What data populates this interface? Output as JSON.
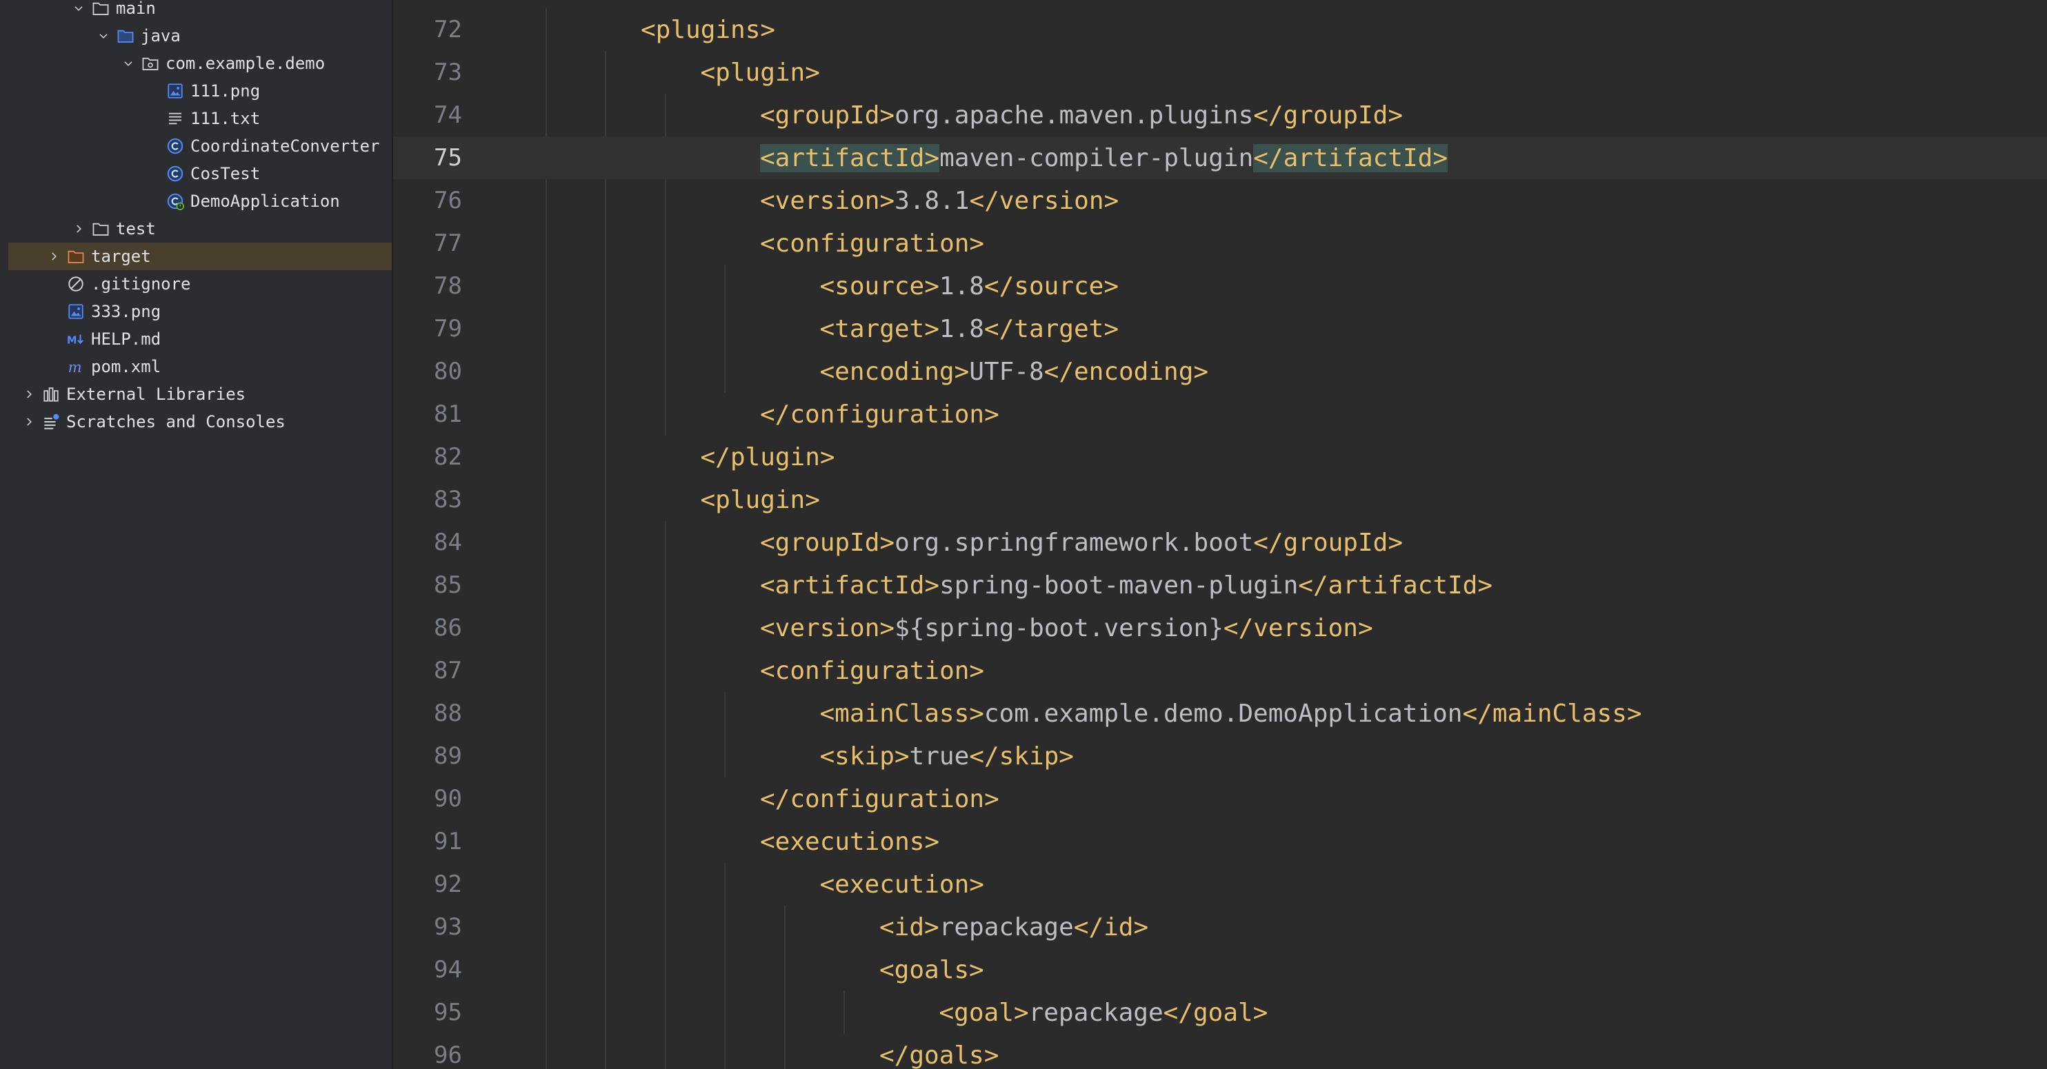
{
  "tree": {
    "rows": [
      {
        "label": "main",
        "indent": 2,
        "chevron": "down",
        "icon": "folder-icon",
        "selected": false
      },
      {
        "label": "java",
        "indent": 3,
        "chevron": "down",
        "icon": "source-folder-icon",
        "selected": false
      },
      {
        "label": "com.example.demo",
        "indent": 4,
        "chevron": "down",
        "icon": "package-icon",
        "selected": false
      },
      {
        "label": "111.png",
        "indent": 5,
        "chevron": "none",
        "icon": "image-file-icon",
        "selected": false
      },
      {
        "label": "111.txt",
        "indent": 5,
        "chevron": "none",
        "icon": "text-file-icon",
        "selected": false
      },
      {
        "label": "CoordinateConverter",
        "indent": 5,
        "chevron": "none",
        "icon": "java-class-icon",
        "selected": false
      },
      {
        "label": "CosTest",
        "indent": 5,
        "chevron": "none",
        "icon": "java-class-icon",
        "selected": false
      },
      {
        "label": "DemoApplication",
        "indent": 5,
        "chevron": "none",
        "icon": "spring-boot-class-icon",
        "selected": false
      },
      {
        "label": "test",
        "indent": 2,
        "chevron": "right",
        "icon": "folder-icon",
        "selected": false
      },
      {
        "label": "target",
        "indent": 1,
        "chevron": "right",
        "icon": "excluded-folder-icon",
        "selected": true
      },
      {
        "label": ".gitignore",
        "indent": 1,
        "chevron": "none",
        "icon": "ignored-file-icon",
        "selected": false
      },
      {
        "label": "333.png",
        "indent": 1,
        "chevron": "none",
        "icon": "image-file-icon",
        "selected": false
      },
      {
        "label": "HELP.md",
        "indent": 1,
        "chevron": "none",
        "icon": "markdown-file-icon",
        "selected": false
      },
      {
        "label": "pom.xml",
        "indent": 1,
        "chevron": "none",
        "icon": "maven-file-icon",
        "selected": false
      },
      {
        "label": "External Libraries",
        "indent": 0,
        "chevron": "right",
        "icon": "library-icon",
        "selected": false
      },
      {
        "label": "Scratches and Consoles",
        "indent": 0,
        "chevron": "right",
        "icon": "scratches-icon",
        "selected": false
      }
    ]
  },
  "editor": {
    "current_line": 75,
    "lines": [
      {
        "num": "72",
        "indent": 2,
        "tokens": [
          {
            "t": "tag",
            "v": "<plugins>"
          }
        ]
      },
      {
        "num": "73",
        "indent": 3,
        "tokens": [
          {
            "t": "tag",
            "v": "<plugin>"
          }
        ]
      },
      {
        "num": "74",
        "indent": 4,
        "tokens": [
          {
            "t": "tag",
            "v": "<groupId>"
          },
          {
            "t": "txt",
            "v": "org.apache.maven.plugins"
          },
          {
            "t": "tag",
            "v": "</groupId>"
          }
        ]
      },
      {
        "num": "75",
        "indent": 4,
        "tokens": [
          {
            "t": "tag",
            "v": "<artifactId>",
            "hl": true
          },
          {
            "t": "txt",
            "v": "maven-compiler-plugin"
          },
          {
            "t": "tag",
            "v": "</artifactId>",
            "hl": true
          }
        ]
      },
      {
        "num": "76",
        "indent": 4,
        "tokens": [
          {
            "t": "tag",
            "v": "<version>"
          },
          {
            "t": "txt",
            "v": "3.8.1"
          },
          {
            "t": "tag",
            "v": "</version>"
          }
        ]
      },
      {
        "num": "77",
        "indent": 4,
        "tokens": [
          {
            "t": "tag",
            "v": "<configuration>"
          }
        ]
      },
      {
        "num": "78",
        "indent": 5,
        "tokens": [
          {
            "t": "tag",
            "v": "<source>"
          },
          {
            "t": "txt",
            "v": "1.8"
          },
          {
            "t": "tag",
            "v": "</source>"
          }
        ]
      },
      {
        "num": "79",
        "indent": 5,
        "tokens": [
          {
            "t": "tag",
            "v": "<target>"
          },
          {
            "t": "txt",
            "v": "1.8"
          },
          {
            "t": "tag",
            "v": "</target>"
          }
        ]
      },
      {
        "num": "80",
        "indent": 5,
        "tokens": [
          {
            "t": "tag",
            "v": "<encoding>"
          },
          {
            "t": "txt",
            "v": "UTF-8"
          },
          {
            "t": "tag",
            "v": "</encoding>"
          }
        ]
      },
      {
        "num": "81",
        "indent": 4,
        "tokens": [
          {
            "t": "tag",
            "v": "</configuration>"
          }
        ]
      },
      {
        "num": "82",
        "indent": 3,
        "tokens": [
          {
            "t": "tag",
            "v": "</plugin>"
          }
        ]
      },
      {
        "num": "83",
        "indent": 3,
        "tokens": [
          {
            "t": "tag",
            "v": "<plugin>"
          }
        ]
      },
      {
        "num": "84",
        "indent": 4,
        "tokens": [
          {
            "t": "tag",
            "v": "<groupId>"
          },
          {
            "t": "txt",
            "v": "org.springframework.boot"
          },
          {
            "t": "tag",
            "v": "</groupId>"
          }
        ]
      },
      {
        "num": "85",
        "indent": 4,
        "tokens": [
          {
            "t": "tag",
            "v": "<artifactId>"
          },
          {
            "t": "txt",
            "v": "spring-boot-maven-plugin"
          },
          {
            "t": "tag",
            "v": "</artifactId>"
          }
        ]
      },
      {
        "num": "86",
        "indent": 4,
        "tokens": [
          {
            "t": "tag",
            "v": "<version>"
          },
          {
            "t": "txt",
            "v": "${spring-boot.version}"
          },
          {
            "t": "tag",
            "v": "</version>"
          }
        ]
      },
      {
        "num": "87",
        "indent": 4,
        "tokens": [
          {
            "t": "tag",
            "v": "<configuration>"
          }
        ]
      },
      {
        "num": "88",
        "indent": 5,
        "tokens": [
          {
            "t": "tag",
            "v": "<mainClass>"
          },
          {
            "t": "txt",
            "v": "com.example.demo.DemoApplication"
          },
          {
            "t": "tag",
            "v": "</mainClass>"
          }
        ]
      },
      {
        "num": "89",
        "indent": 5,
        "tokens": [
          {
            "t": "tag",
            "v": "<skip>"
          },
          {
            "t": "txt",
            "v": "true"
          },
          {
            "t": "tag",
            "v": "</skip>"
          }
        ]
      },
      {
        "num": "90",
        "indent": 4,
        "tokens": [
          {
            "t": "tag",
            "v": "</configuration>"
          }
        ]
      },
      {
        "num": "91",
        "indent": 4,
        "tokens": [
          {
            "t": "tag",
            "v": "<executions>"
          }
        ]
      },
      {
        "num": "92",
        "indent": 5,
        "tokens": [
          {
            "t": "tag",
            "v": "<execution>"
          }
        ]
      },
      {
        "num": "93",
        "indent": 6,
        "tokens": [
          {
            "t": "tag",
            "v": "<id>"
          },
          {
            "t": "txt",
            "v": "repackage"
          },
          {
            "t": "tag",
            "v": "</id>"
          }
        ]
      },
      {
        "num": "94",
        "indent": 6,
        "tokens": [
          {
            "t": "tag",
            "v": "<goals>"
          }
        ]
      },
      {
        "num": "95",
        "indent": 7,
        "tokens": [
          {
            "t": "tag",
            "v": "<goal>"
          },
          {
            "t": "txt",
            "v": "repackage"
          },
          {
            "t": "tag",
            "v": "</goal>"
          }
        ]
      },
      {
        "num": "96",
        "indent": 6,
        "tokens": [
          {
            "t": "tag",
            "v": "</goals>"
          }
        ]
      }
    ]
  },
  "colors": {
    "tag": "#e8bf6a",
    "text": "#bcbec4",
    "gutter": "#7a7e85",
    "match_highlight": "#3b514d"
  }
}
